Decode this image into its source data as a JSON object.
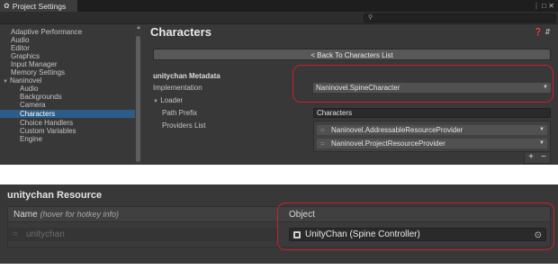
{
  "window": {
    "tab_title": "Project Settings",
    "controls": "⋮ □ ✕"
  },
  "sidebar": {
    "items": [
      {
        "label": "Adaptive Performance"
      },
      {
        "label": "Audio"
      },
      {
        "label": "Editor"
      },
      {
        "label": "Graphics"
      },
      {
        "label": "Input Manager"
      },
      {
        "label": "Memory Settings"
      },
      {
        "label": "Naninovel"
      },
      {
        "label": "Audio"
      },
      {
        "label": "Backgrounds"
      },
      {
        "label": "Camera"
      },
      {
        "label": "Characters"
      },
      {
        "label": "Choice Handlers"
      },
      {
        "label": "Custom Variables"
      },
      {
        "label": "Engine"
      }
    ]
  },
  "main": {
    "title": "Characters",
    "back_button": "< Back To Characters List",
    "metadata_title": "unitychan Metadata",
    "implementation_label": "Implementation",
    "implementation_value": "Naninovel.SpineCharacter",
    "loader_label": "Loader",
    "path_prefix_label": "Path Prefix",
    "path_prefix_value": "Characters",
    "providers_label": "Providers List",
    "providers": [
      {
        "label": "Naninovel.AddressableResourceProvider"
      },
      {
        "label": "Naninovel.ProjectResourceProvider"
      }
    ],
    "add_label": "+",
    "remove_label": "−"
  },
  "resource": {
    "title": "unitychan Resource",
    "name_header": "Name",
    "name_hint": "(hover for hotkey info)",
    "object_header": "Object",
    "name_value": "unitychan",
    "object_value": "UnityChan (Spine Controller)"
  },
  "icons": {
    "tab": "gear-icon",
    "search": "search-icon",
    "help": "help-icon",
    "settings": "settings-icon",
    "picker": "object-picker-icon"
  },
  "colors": {
    "selection": "#2c5d87",
    "highlight": "#c8202a",
    "panel": "#383838"
  }
}
